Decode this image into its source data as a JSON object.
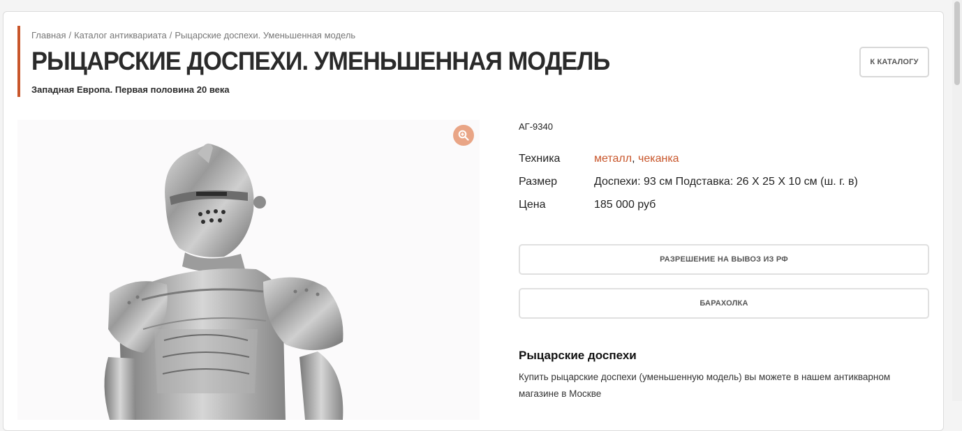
{
  "breadcrumb": {
    "home": "Главная",
    "separator": "/",
    "catalog": "Каталог антиквариата",
    "current": "Рыцарские доспехи. Уменьшенная модель"
  },
  "product": {
    "title": "РЫЦАРСКИЕ ДОСПЕХИ. УМЕНЬШЕННАЯ МОДЕЛЬ",
    "subtitle": "Западная Европа. Первая половина 20 века",
    "article": "АГ-9340",
    "technique_label": "Техника",
    "technique_values": [
      "металл",
      "чеканка"
    ],
    "technique_separator": ",",
    "size_label": "Размер",
    "size_value": "Доспехи: 93 см Подставка: 26 X 25 X 10 см (ш. г. в)",
    "price_label": "Цена",
    "price_value": "185 000 руб"
  },
  "buttons": {
    "catalog": "К КАТАЛОГУ",
    "export_permit": "РАЗРЕШЕНИЕ НА ВЫВОЗ ИЗ РФ",
    "flea_market": "БАРАХОЛКА"
  },
  "description": {
    "title": "Рыцарские доспехи",
    "text": "Купить рыцарские доспехи (уменьшенную модель) вы можете в нашем антикварном магазине в Москве"
  },
  "colors": {
    "accent": "#c8562b",
    "zoom_button": "#e9a586"
  },
  "icons": {
    "zoom": "zoom-in-icon"
  }
}
